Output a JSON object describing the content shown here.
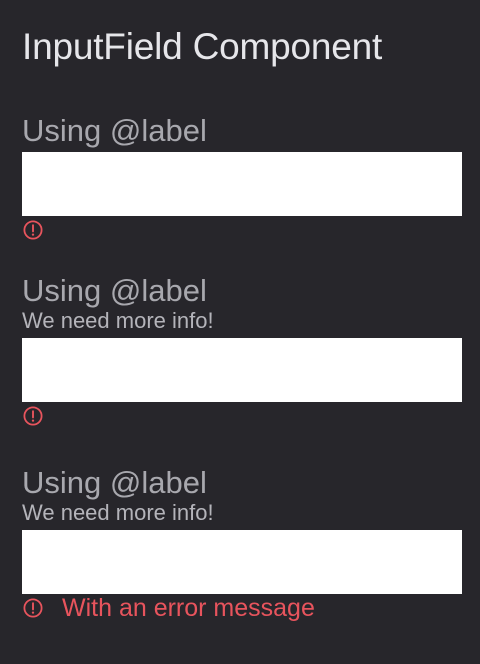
{
  "page": {
    "title": "InputField Component"
  },
  "colors": {
    "background": "#27262b",
    "label": "#a8a8ae",
    "error": "#e8545d",
    "input_background": "#ffffff"
  },
  "fields": [
    {
      "label": "Using @label",
      "hint": "",
      "value": "",
      "error_icon": "alert-circle-icon",
      "error_message": ""
    },
    {
      "label": "Using @label",
      "hint": "We need more info!",
      "value": "",
      "error_icon": "alert-circle-icon",
      "error_message": ""
    },
    {
      "label": "Using @label",
      "hint": "We need more info!",
      "value": "",
      "error_icon": "alert-circle-icon",
      "error_message": "With an error message"
    }
  ]
}
